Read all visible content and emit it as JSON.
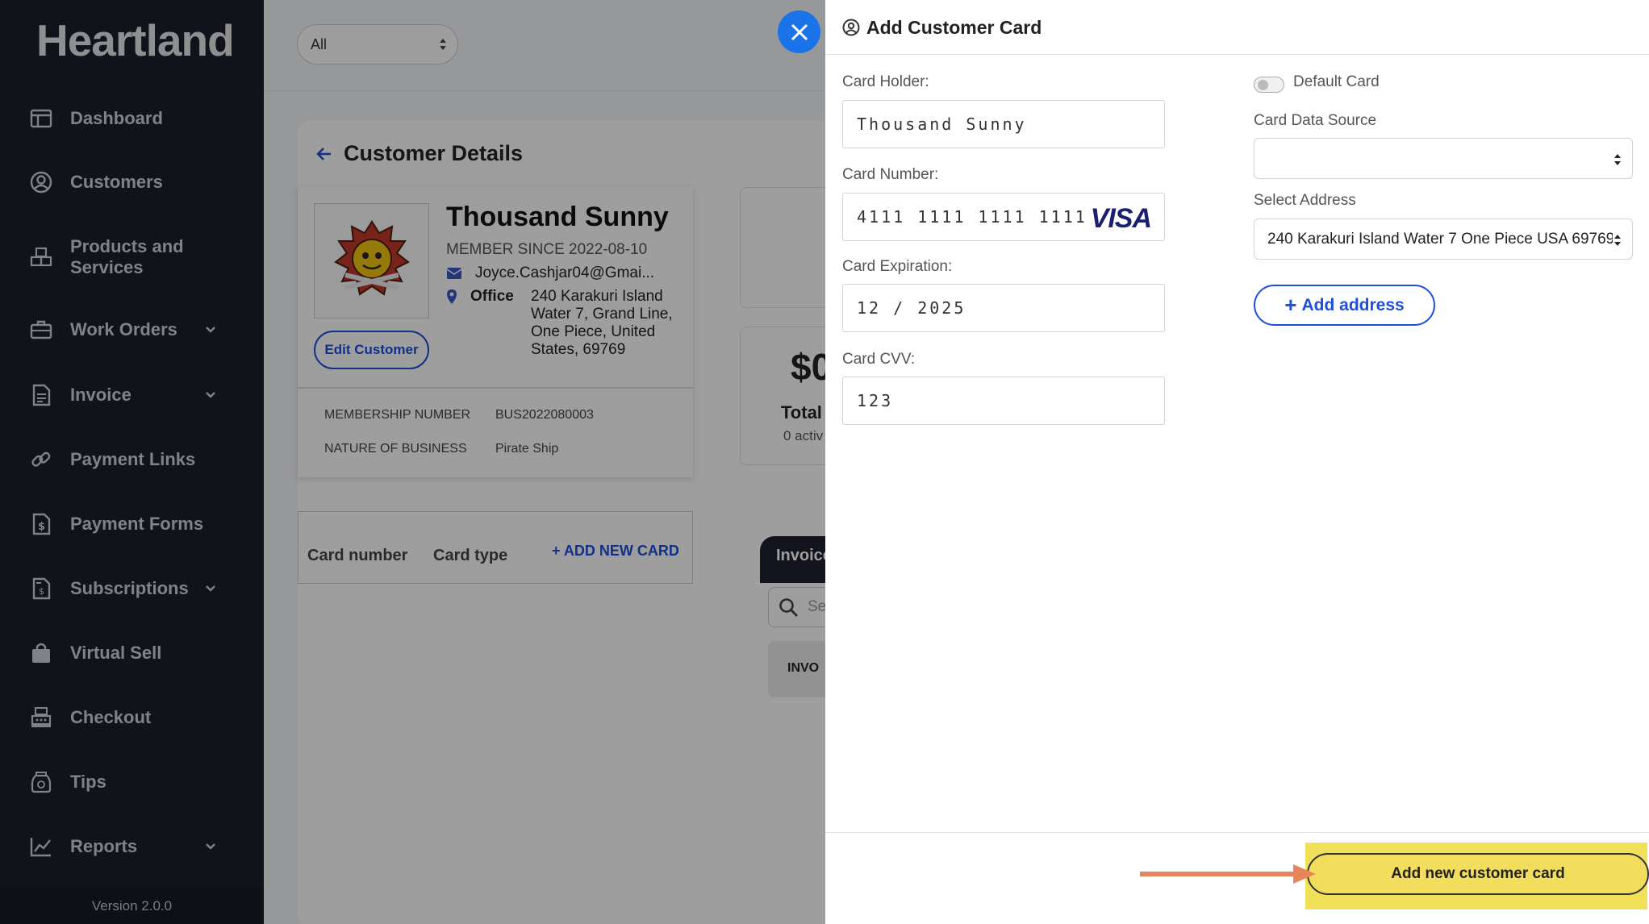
{
  "app": {
    "brand": "Heartland",
    "version": "Version 2.0.0"
  },
  "sidebar": {
    "items": [
      {
        "label": "Dashboard",
        "icon": "dashboard-icon",
        "chevron": false
      },
      {
        "label": "Customers",
        "icon": "user-circle-icon",
        "chevron": false
      },
      {
        "label": "Products and Services",
        "icon": "boxes-icon",
        "chevron": false
      },
      {
        "label": "Work Orders",
        "icon": "briefcase-icon",
        "chevron": true
      },
      {
        "label": "Invoice",
        "icon": "document-icon",
        "chevron": true
      },
      {
        "label": "Payment Links",
        "icon": "link-icon",
        "chevron": false
      },
      {
        "label": "Payment Forms",
        "icon": "dollar-file-icon",
        "chevron": false
      },
      {
        "label": "Subscriptions",
        "icon": "receipt-icon",
        "chevron": true
      },
      {
        "label": "Virtual Sell",
        "icon": "shopping-bag-icon",
        "chevron": false
      },
      {
        "label": "Checkout",
        "icon": "cash-register-icon",
        "chevron": false
      },
      {
        "label": "Tips",
        "icon": "tip-jar-icon",
        "chevron": false
      },
      {
        "label": "Reports",
        "icon": "chart-icon",
        "chevron": true
      }
    ]
  },
  "main": {
    "filter": {
      "value": "All"
    },
    "title": "Customer Details",
    "customer": {
      "name": "Thousand Sunny",
      "member_since": "MEMBER SINCE 2022-08-10",
      "email": "Joyce.Cashjar04@Gmai...",
      "office_label": "Office",
      "address": "240 Karakuri Island Water 7, Grand Line, One Piece, United States, 69769",
      "edit_label": "Edit Customer",
      "membership_number_label": "MEMBERSHIP NUMBER",
      "membership_number": "BUS2022080003",
      "nature_label": "NATURE OF BUSINESS",
      "nature": "Pirate Ship"
    },
    "cards_table": {
      "col_number": "Card number",
      "col_type": "Card type",
      "add_label": "+ ADD NEW CARD"
    },
    "stats": {
      "amount": "$0",
      "total": "Total",
      "active": "0 activ"
    },
    "invoices": {
      "tab": "Invoices",
      "search_placeholder": "Se",
      "column": "INVO"
    }
  },
  "modal": {
    "title": "Add Customer Card",
    "card_holder": {
      "label": "Card Holder:",
      "value": "Thousand Sunny"
    },
    "card_number": {
      "label": "Card Number:",
      "value": "4111 1111 1111 1111",
      "brand": "VISA"
    },
    "card_expiration": {
      "label": "Card Expiration:",
      "value": "12 / 2025"
    },
    "card_cvv": {
      "label": "Card CVV:",
      "value": "123"
    },
    "default_card": {
      "label": "Default Card",
      "on": false
    },
    "card_data_source": {
      "label": "Card Data Source",
      "value": ""
    },
    "select_address": {
      "label": "Select Address",
      "value": "240 Karakuri Island Water 7 One Piece USA 69769"
    },
    "add_address_label": "Add address",
    "submit_label": "Add new customer card"
  },
  "colors": {
    "sidebar_bg": "#1d1f2b",
    "accent_blue": "#1d4fd8",
    "close_blue": "#1a73e8",
    "highlight": "#f0e05a",
    "annotation_arrow": "#e8855a"
  }
}
